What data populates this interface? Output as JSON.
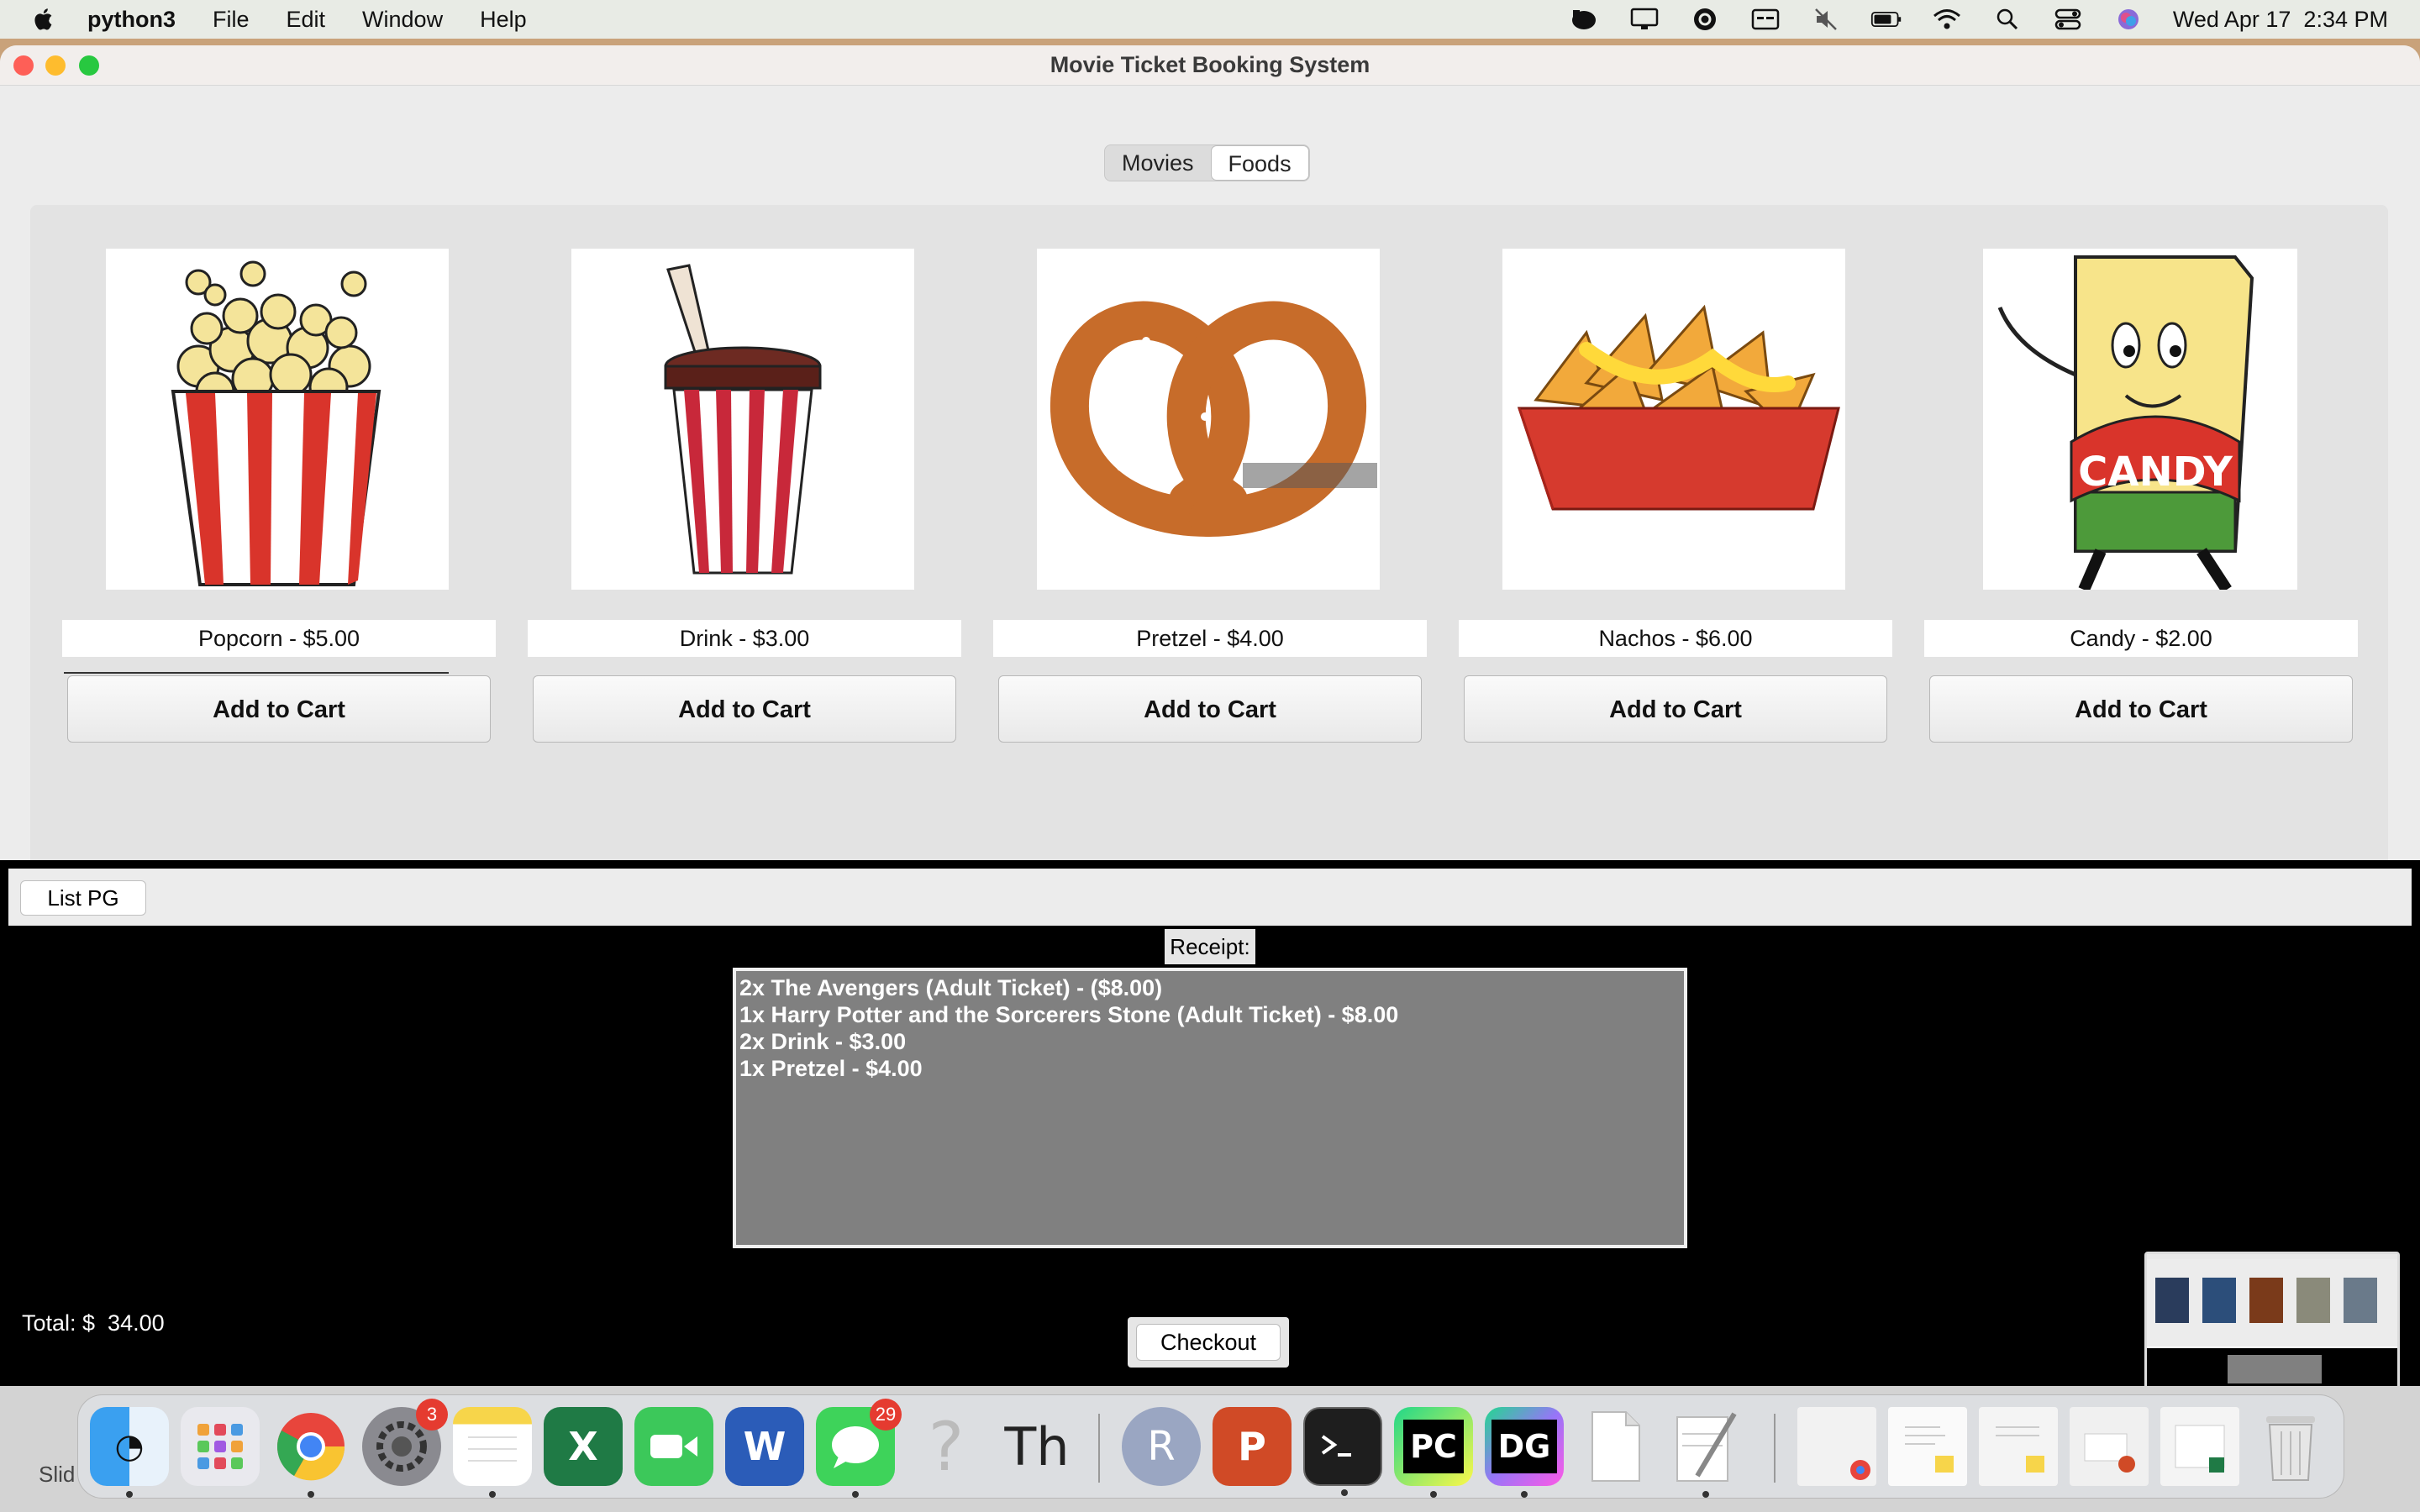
{
  "menubar": {
    "app_name": "python3",
    "items": [
      "File",
      "Edit",
      "Window",
      "Help"
    ],
    "datetime": "Wed Apr 17  2:34 PM",
    "status_icons": [
      "evernote-icon",
      "display-icon",
      "grammarly-icon",
      "caption-icon",
      "mute-icon",
      "battery-icon",
      "wifi-icon",
      "search-icon",
      "control-center-icon",
      "siri-icon"
    ]
  },
  "window": {
    "title": "Movie Ticket Booking System",
    "tabs": [
      {
        "label": "Movies",
        "active": false
      },
      {
        "label": "Foods",
        "active": true
      }
    ]
  },
  "foods": [
    {
      "name": "Popcorn",
      "label": "Popcorn - $5.00",
      "button": "Add to Cart",
      "image": "popcorn-image"
    },
    {
      "name": "Drink",
      "label": "Drink - $3.00",
      "button": "Add to Cart",
      "image": "drink-image"
    },
    {
      "name": "Pretzel",
      "label": "Pretzel - $4.00",
      "button": "Add to Cart",
      "image": "pretzel-image"
    },
    {
      "name": "Nachos",
      "label": "Nachos - $6.00",
      "button": "Add to Cart",
      "image": "nachos-image"
    },
    {
      "name": "Candy",
      "label": "Candy - $2.00",
      "button": "Add to Cart",
      "image": "candy-image"
    }
  ],
  "lower": {
    "list_button": "List PG",
    "receipt_label": "Receipt:",
    "receipt_lines": [
      "2x The Avengers (Adult Ticket) - ($8.00)",
      "1x Harry Potter and the Sorcerers Stone (Adult Ticket) - $8.00",
      "2x Drink - $3.00",
      "1x Pretzel - $4.00"
    ],
    "total": "Total: $  34.00",
    "checkout": "Checkout"
  },
  "behind_window_text": "Slid",
  "dock": {
    "apps": [
      "finder",
      "launchpad",
      "chrome",
      "system-settings",
      "notes",
      "excel",
      "facetime",
      "word",
      "messages",
      "help",
      "typora",
      "r",
      "powerpoint",
      "terminal",
      "pycharm",
      "datagrip",
      "document",
      "textedit"
    ],
    "badges": {
      "system-settings": "3",
      "messages": "29"
    },
    "labels": {
      "pycharm": "PC",
      "datagrip": "DG",
      "r": "R",
      "excel": "X",
      "word": "W",
      "powerpoint": "P",
      "typora": "Th",
      "help": "?"
    }
  },
  "colors": {
    "accent_red": "#e53b30",
    "receipt_bg": "#808080",
    "lower_bg": "#000000"
  }
}
